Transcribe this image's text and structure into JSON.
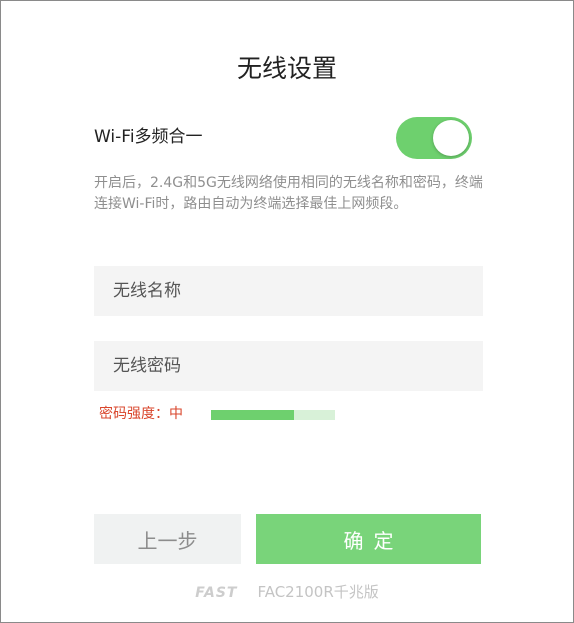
{
  "page": {
    "title": "无线设置"
  },
  "multiband": {
    "label": "Wi-Fi多频合一",
    "enabled": true,
    "description": "开启后，2.4G和5G无线网络使用相同的无线名称和密码，终端连接Wi-Fi时，路由自动为终端选择最佳上网频段。",
    "toggle_color": "#6ed06e"
  },
  "ssid": {
    "value": "",
    "placeholder": "无线名称"
  },
  "password": {
    "value": "",
    "placeholder": "无线密码"
  },
  "strength": {
    "label": "密码强度：中",
    "level_fraction": 0.67,
    "color": "#6ed06e",
    "label_color": "#d9452b"
  },
  "buttons": {
    "prev_label": "上一步",
    "ok_label": "确定",
    "ok_color": "#79d47a"
  },
  "footer": {
    "brand": "FAST",
    "model": "FAC2100R千兆版"
  }
}
